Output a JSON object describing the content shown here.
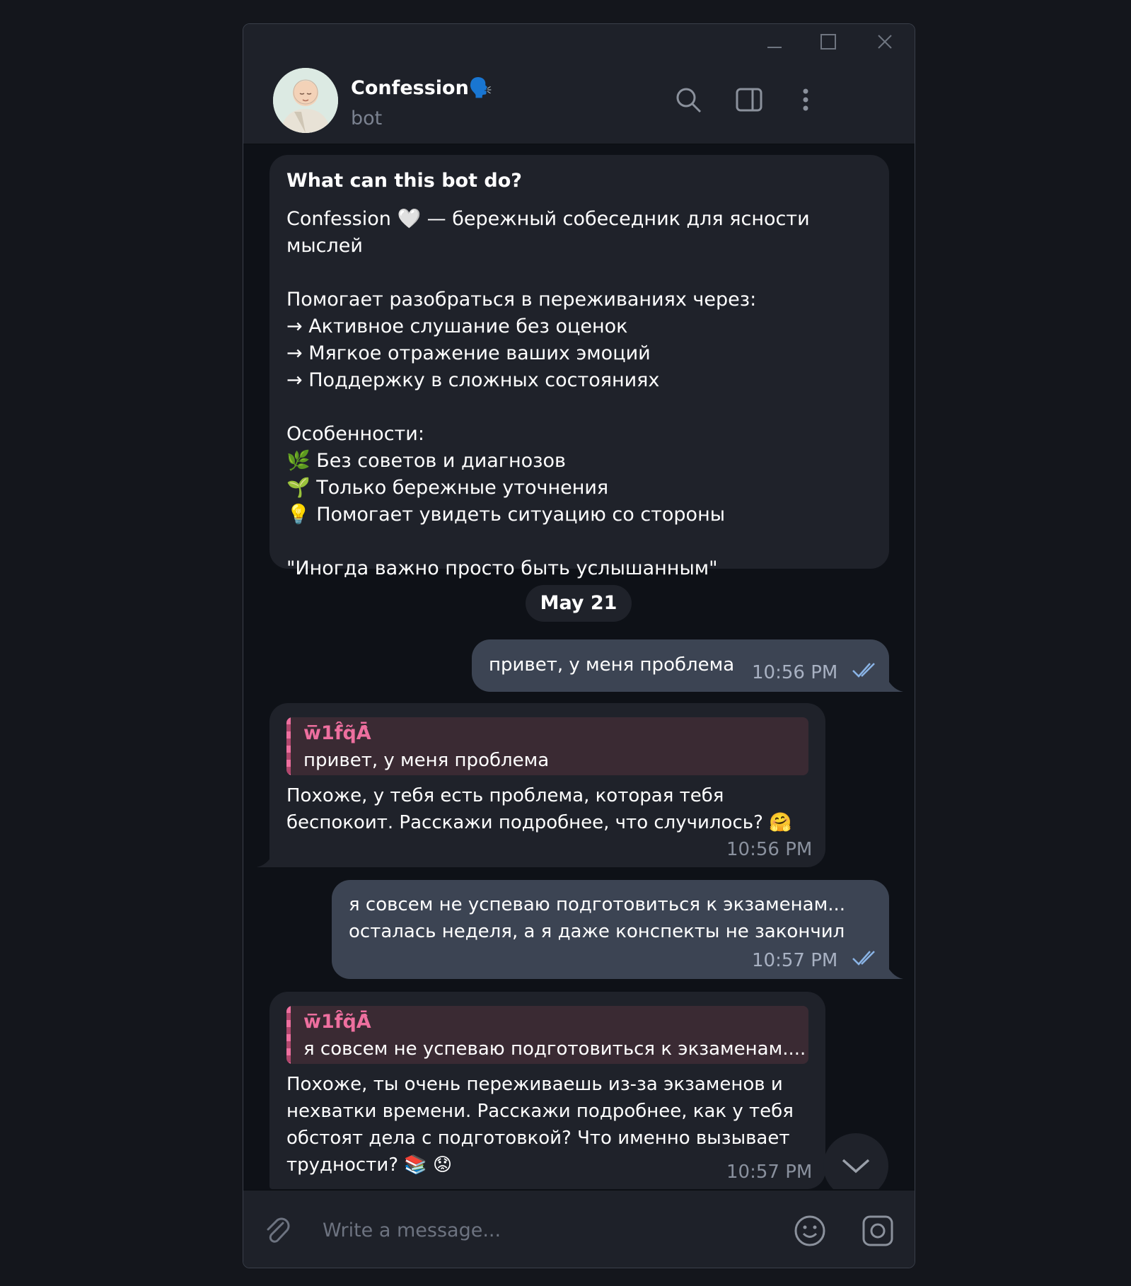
{
  "window": {
    "controls": [
      "minimize-icon",
      "maximize-icon",
      "close-icon"
    ]
  },
  "header": {
    "title": "Confession🗣️",
    "subtitle": "bot",
    "icons": [
      "search-icon",
      "sidebar-toggle-icon",
      "more-vertical-icon"
    ]
  },
  "intro": {
    "title": "What can this bot do?",
    "body": "Confession 🤍 — бережный собеседник для ясности мыслей\n\nПомогает разобраться в переживаниях через:\n→ Активное слушание без оценок\n→ Мягкое отражение ваших эмоций\n→ Поддержку в сложных состояниях\n\nОсобенности:\n🌿 Без советов и диагнозов\n🌱 Только бережные уточнения\n💡 Помогает увидеть ситуацию со стороны\n\n\"Иногда важно просто быть услышанным\""
  },
  "date_separator": "May 21",
  "messages": [
    {
      "from": "me",
      "text": "привет, у меня проблема",
      "time": "10:56 PM"
    },
    {
      "from": "bot",
      "reply_name": "w̅1f̂q̃Ā̀",
      "reply_text": "привет, у меня проблема",
      "text": "Похоже, у тебя есть проблема, которая тебя\nбеспокоит. Расскажи подробнее, что случилось? 🤗",
      "time": "10:56 PM"
    },
    {
      "from": "me",
      "text": "я совсем не успеваю подготовиться к экзаменам...\nосталась неделя, а я даже конспекты не закончил",
      "time": "10:57 PM"
    },
    {
      "from": "bot",
      "reply_name": "w̅1f̂q̃Ā̀",
      "reply_text": "я совсем не успеваю подготовиться к экзаменам....",
      "text": "Похоже, ты очень переживаешь из-за экзаменов и\nнехватки времени. Расскажи подробнее, как у тебя\nобстоят дела с подготовкой? Что именно вызывает\nтрудности? 📚 😟",
      "time": "10:57 PM"
    }
  ],
  "composer": {
    "placeholder": "Write a message..."
  },
  "colors": {
    "accent_reply": "#ee6f9f",
    "outgoing_bubble": "#3c4453",
    "incoming_bubble": "#1f222a"
  }
}
